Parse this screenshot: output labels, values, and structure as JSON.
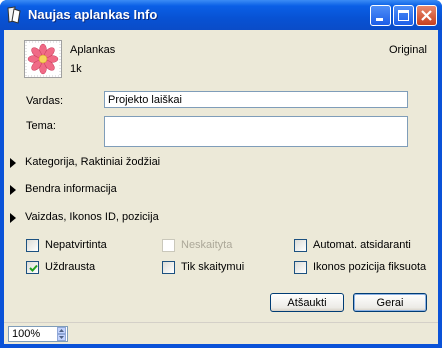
{
  "window": {
    "title": "Naujas aplankas Info"
  },
  "folder": {
    "name": "Aplankas",
    "size": "1k",
    "status": "Original"
  },
  "fields": {
    "name_label": "Vardas:",
    "name_value": "Projekto laiškai",
    "subject_label": "Tema:",
    "subject_value": ""
  },
  "sections": [
    {
      "label": "Kategorija, Raktiniai žodžiai",
      "expanded": false
    },
    {
      "label": "Bendra informacija",
      "expanded": false
    },
    {
      "label": "Vaizdas, Ikonos ID, pozicija",
      "expanded": false
    }
  ],
  "checkboxes": [
    {
      "label": "Nepatvirtinta",
      "checked": false,
      "enabled": true
    },
    {
      "label": "Neskaityta",
      "checked": false,
      "enabled": false
    },
    {
      "label": "Automat. atsidaranti",
      "checked": false,
      "enabled": true
    },
    {
      "label": "Uždrausta",
      "checked": true,
      "enabled": true
    },
    {
      "label": "Tik skaitymui",
      "checked": false,
      "enabled": true
    },
    {
      "label": "Ikonos pozicija fiksuota",
      "checked": false,
      "enabled": true
    }
  ],
  "buttons": {
    "cancel": "Atšaukti",
    "ok": "Gerai"
  },
  "statusbar": {
    "zoom": "100%"
  },
  "colors": {
    "titlebar": "#0a52d8",
    "client_bg": "#ece9d8",
    "close_button": "#c8401f",
    "disabled_text": "#aca899"
  },
  "icons": [
    "app-icon",
    "minimize-icon",
    "maximize-icon",
    "close-icon",
    "flower-folder-icon",
    "expand-triangle-icon",
    "checkmark-icon",
    "spin-up-icon",
    "spin-down-icon"
  ]
}
